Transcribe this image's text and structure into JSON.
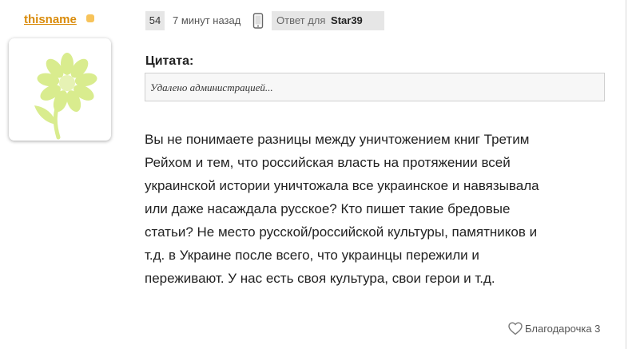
{
  "author": {
    "username": "thisname",
    "status_color": "#f7c35a"
  },
  "post": {
    "number": "54",
    "time": "7 минут назад",
    "device_icon": "phone-icon",
    "reply_label": "Ответ для",
    "reply_user": "Star39",
    "quote_title": "Цитата:",
    "quote_text": "Удалено администрацией...",
    "body_lines": [
      "Вы не понимаете разницы между уничтожением книг Третим",
      "Рейхом и тем, что российская власть на протяжении всей",
      "украинской истории уничтожала все украинское и навязывала",
      "или даже насаждала русское? Кто пишет такие бредовые",
      "статьи? Не место русской/российской культуры, памятников и",
      "т.д. в Украине после всего, что украинцы пережили и",
      "переживают. У нас есть своя культура, свои герои и т.д."
    ]
  },
  "thanks": {
    "label": "Благодарочка 3",
    "icon": "heart-icon"
  },
  "colors": {
    "username": "#d98b0a",
    "flower": "#d9ec8e",
    "badge_bg": "#e6e6e6"
  }
}
